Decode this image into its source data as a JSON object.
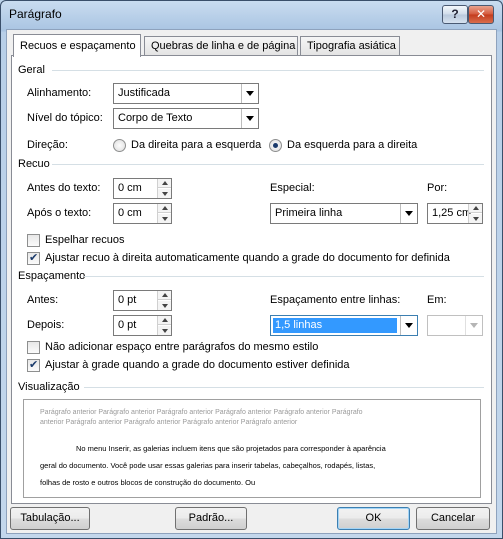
{
  "window": {
    "title": "Parágrafo",
    "help_label": "?",
    "close_label": "✕"
  },
  "tabs": [
    {
      "label": "Recuos e espaçamento",
      "active": true
    },
    {
      "label": "Quebras de linha e de página",
      "active": false
    },
    {
      "label": "Tipografia asiática",
      "active": false
    }
  ],
  "general": {
    "section_label": "Geral",
    "alignment_label": "Alinhamento:",
    "alignment_value": "Justificada",
    "outline_label": "Nível do tópico:",
    "outline_value": "Corpo de Texto",
    "direction_label": "Direção:",
    "rtl_label": "Da direita para a esquerda",
    "ltr_label": "Da esquerda para a direita",
    "direction_selected": "ltr"
  },
  "indent": {
    "section_label": "Recuo",
    "before_label": "Antes do texto:",
    "before_value": "0 cm",
    "after_label": "Após o texto:",
    "after_value": "0 cm",
    "special_label": "Especial:",
    "special_value": "Primeira linha",
    "by_label": "Por:",
    "by_value": "1,25 cm",
    "mirror_label": "Espelhar recuos",
    "mirror_checked": false,
    "auto_adjust_label": "Ajustar recuo à direita automaticamente quando a grade do documento for definida",
    "auto_adjust_checked": true
  },
  "spacing": {
    "section_label": "Espaçamento",
    "before_label": "Antes:",
    "before_value": "0 pt",
    "after_label": "Depois:",
    "after_value": "0 pt",
    "line_spacing_label": "Espaçamento entre linhas:",
    "line_spacing_value": "1,5 linhas",
    "at_label": "Em:",
    "at_value": "",
    "no_space_label": "Não adicionar espaço entre parágrafos do mesmo estilo",
    "no_space_checked": false,
    "snap_grid_label": "Ajustar à grade quando a grade do documento estiver definida",
    "snap_grid_checked": true
  },
  "preview": {
    "section_label": "Visualização",
    "prev_line_1": "Parágrafo anterior Parágrafo anterior Parágrafo anterior Parágrafo anterior Parágrafo anterior Parágrafo",
    "prev_line_2": "anterior Parágrafo anterior Parágrafo anterior Parágrafo anterior Parágrafo anterior",
    "body_line_1": "No menu Inserir, as galerias incluem itens que são projetados para corresponder à aparência",
    "body_line_2": "geral do documento. Você pode usar essas galerias para inserir tabelas, cabeçalhos, rodapés, listas,",
    "body_line_3": "folhas de rosto e outros blocos de construção do documento. Ou"
  },
  "buttons": {
    "tabs_label": "Tabulação...",
    "default_label": "Padrão...",
    "ok_label": "OK",
    "cancel_label": "Cancelar"
  }
}
